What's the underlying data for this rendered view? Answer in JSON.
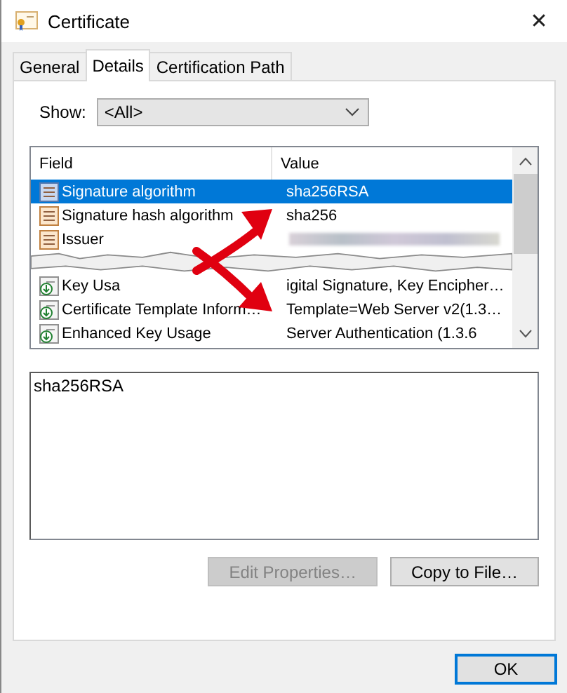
{
  "window": {
    "title": "Certificate",
    "close": "✕"
  },
  "tabs": [
    {
      "label": "General",
      "selected": false
    },
    {
      "label": "Details",
      "selected": true
    },
    {
      "label": "Certification Path",
      "selected": false
    }
  ],
  "show": {
    "label": "Show:",
    "value": "<All>"
  },
  "table": {
    "columns": [
      "Field",
      "Value"
    ],
    "rows_above": [
      {
        "kind": "basic",
        "field": "Signature algorithm",
        "value": "sha256RSA",
        "selected": true,
        "redacted": false
      },
      {
        "kind": "basic",
        "field": "Signature hash algorithm",
        "value": "sha256",
        "selected": false,
        "redacted": false
      },
      {
        "kind": "basic",
        "field": "Issuer",
        "selected": false,
        "redacted": true
      }
    ],
    "rows_below": [
      {
        "kind": "extension",
        "field": "Key Usa",
        "value": "igital Signature, Key Encipher…",
        "selected": false,
        "redacted": false
      },
      {
        "kind": "extension",
        "field": "Certificate Template Inform…",
        "value": "Template=Web Server v2(1.3…",
        "selected": false,
        "redacted": false
      },
      {
        "kind": "extension",
        "field": "Enhanced Key Usage",
        "value": "Server Authentication (1.3.6",
        "selected": false,
        "redacted": false
      }
    ]
  },
  "detail_text": "sha256RSA",
  "buttons": [
    {
      "label": "Edit Properties…",
      "disabled": true
    },
    {
      "label": "Copy to File…",
      "disabled": false
    }
  ],
  "ok_button": "OK"
}
